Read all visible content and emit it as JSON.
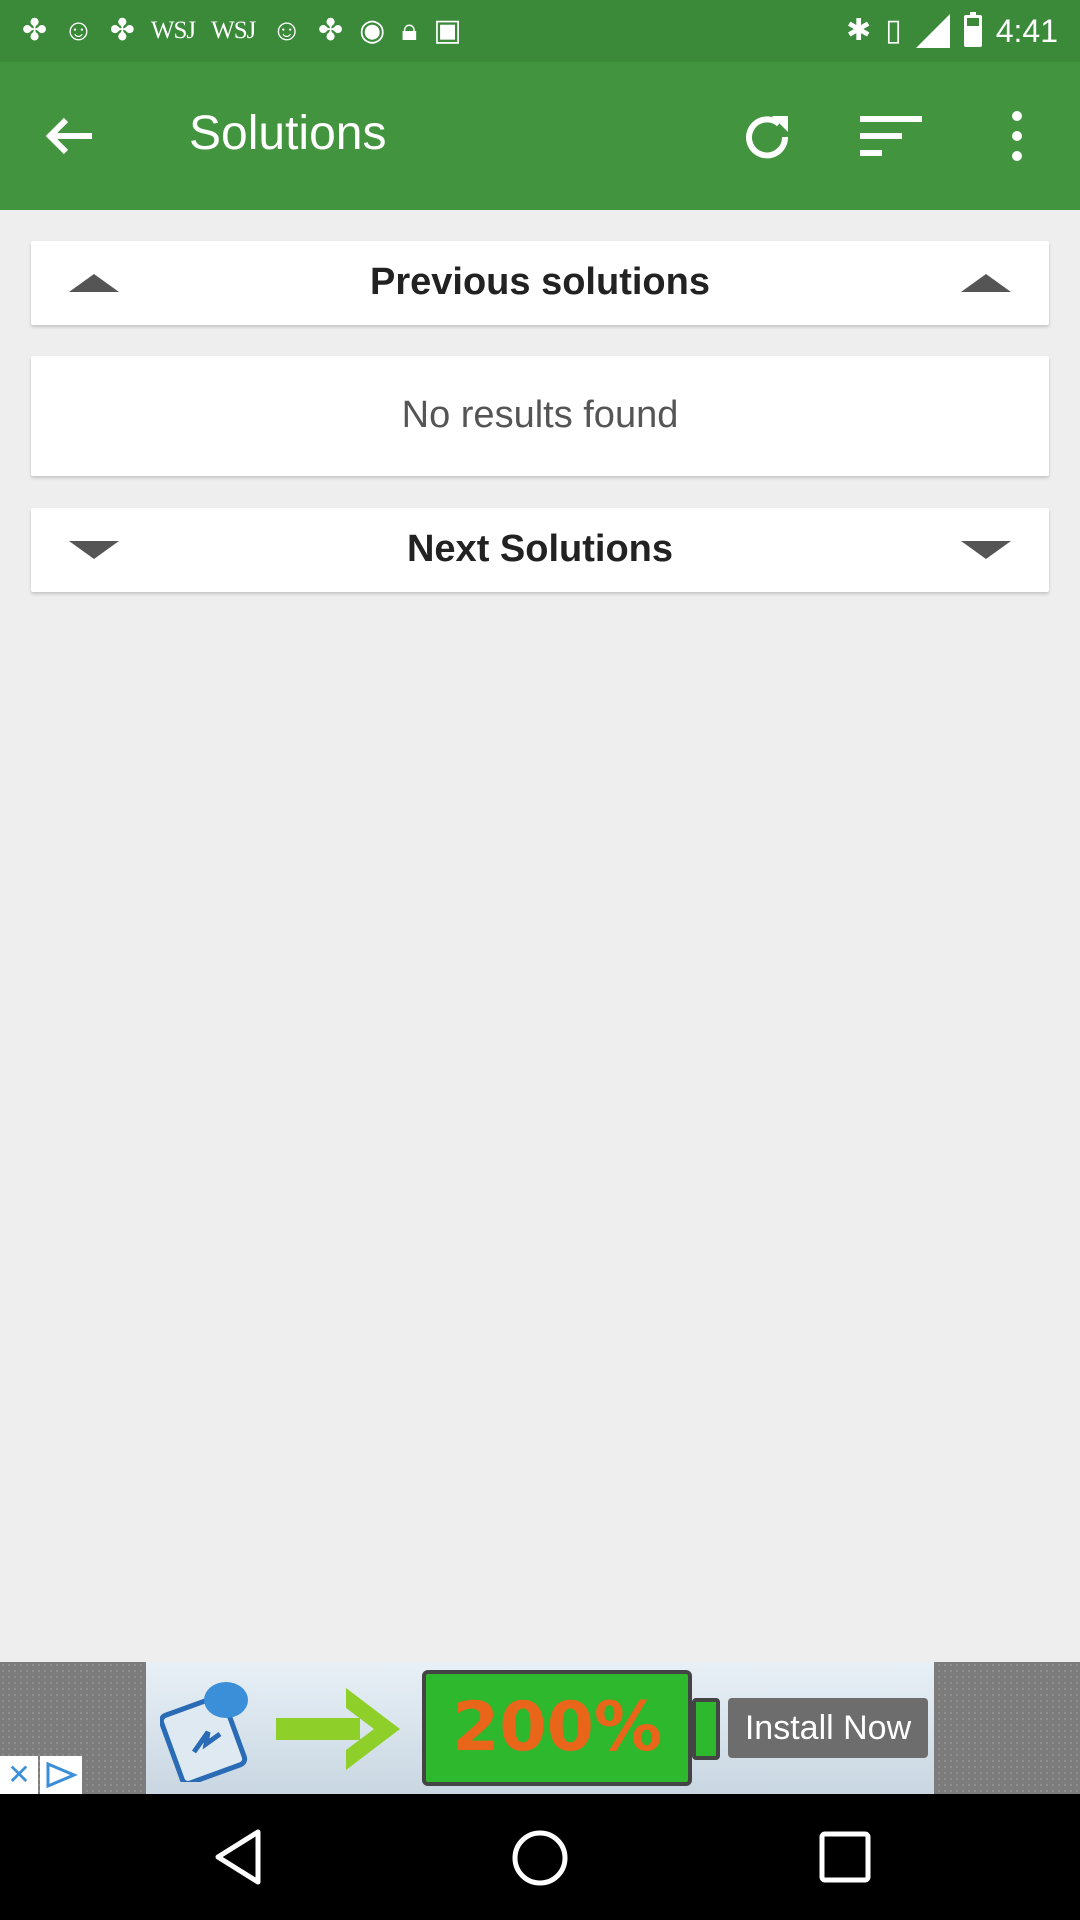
{
  "status_bar": {
    "left_icons": [
      "pinwheel-icon",
      "smiley-icon",
      "pinwheel-icon",
      "wsj-icon",
      "wsj-icon",
      "smiley-icon",
      "pinwheel-icon",
      "circle-info-icon",
      "lock-icon",
      "android-icon"
    ],
    "wsj_label": "WSJ",
    "time": "4:41"
  },
  "app_bar": {
    "title": "Solutions",
    "color": "#43943f"
  },
  "sections": {
    "previous_label": "Previous solutions",
    "empty_label": "No results found",
    "next_label": "Next Solutions"
  },
  "ad": {
    "percent_text": "200%",
    "cta_label": "Install Now"
  }
}
